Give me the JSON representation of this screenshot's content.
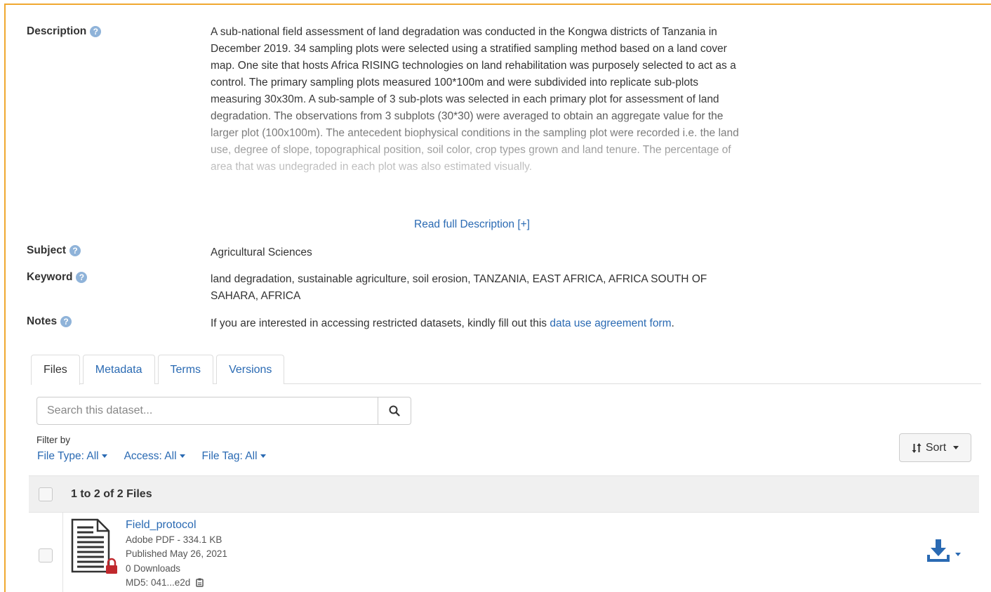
{
  "description": {
    "label": "Description",
    "text": "A sub-national field assessment of land degradation was conducted in the Kongwa districts of Tanzania in December 2019. 34 sampling plots were selected using a stratified sampling method based on a land cover map. One site that hosts Africa RISING technologies on land rehabilitation was purposely selected to act as a control. The primary sampling plots measured 100*100m and were subdivided into replicate sub-plots measuring 30x30m. A sub-sample of 3 sub-plots was selected in each primary plot for assessment of land degradation. The observations from 3 subplots (30*30) were averaged to obtain an aggregate value for the larger plot (100x100m). The antecedent biophysical conditions in the sampling plot were recorded i.e. the land use, degree of slope, topographical position, soil color, crop types grown and land tenure. The percentage of area that was undegraded in each plot was also estimated visually.",
    "read_more": "Read full Description [+]"
  },
  "subject": {
    "label": "Subject",
    "value": "Agricultural Sciences"
  },
  "keyword": {
    "label": "Keyword",
    "value": "land degradation, sustainable agriculture, soil erosion, TANZANIA, EAST AFRICA, AFRICA SOUTH OF SAHARA, AFRICA"
  },
  "notes": {
    "label": "Notes",
    "text_before": "If you are interested in accessing restricted datasets, kindly fill out this ",
    "link": "data use agreement form",
    "text_after": "."
  },
  "tabs": [
    "Files",
    "Metadata",
    "Terms",
    "Versions"
  ],
  "search": {
    "placeholder": "Search this dataset..."
  },
  "filter": {
    "label": "Filter by",
    "file_type": "File Type: All",
    "access": "Access: All",
    "file_tag": "File Tag: All"
  },
  "sort": {
    "label": "Sort"
  },
  "table": {
    "count": "1 to 2 of 2 Files",
    "files": [
      {
        "name": "Field_protocol",
        "type_size": "Adobe PDF - 334.1 KB",
        "published": "Published May 26, 2021",
        "downloads": "0 Downloads",
        "md5": "MD5: 041...e2d"
      }
    ]
  },
  "icons": [
    "help-icon",
    "search-icon",
    "sort-icon",
    "file-icon",
    "lock-icon",
    "clipboard-icon",
    "download-icon"
  ],
  "colors": {
    "link": "#2a6ab3",
    "frame": "#f0a830",
    "lock": "#c0282d"
  }
}
